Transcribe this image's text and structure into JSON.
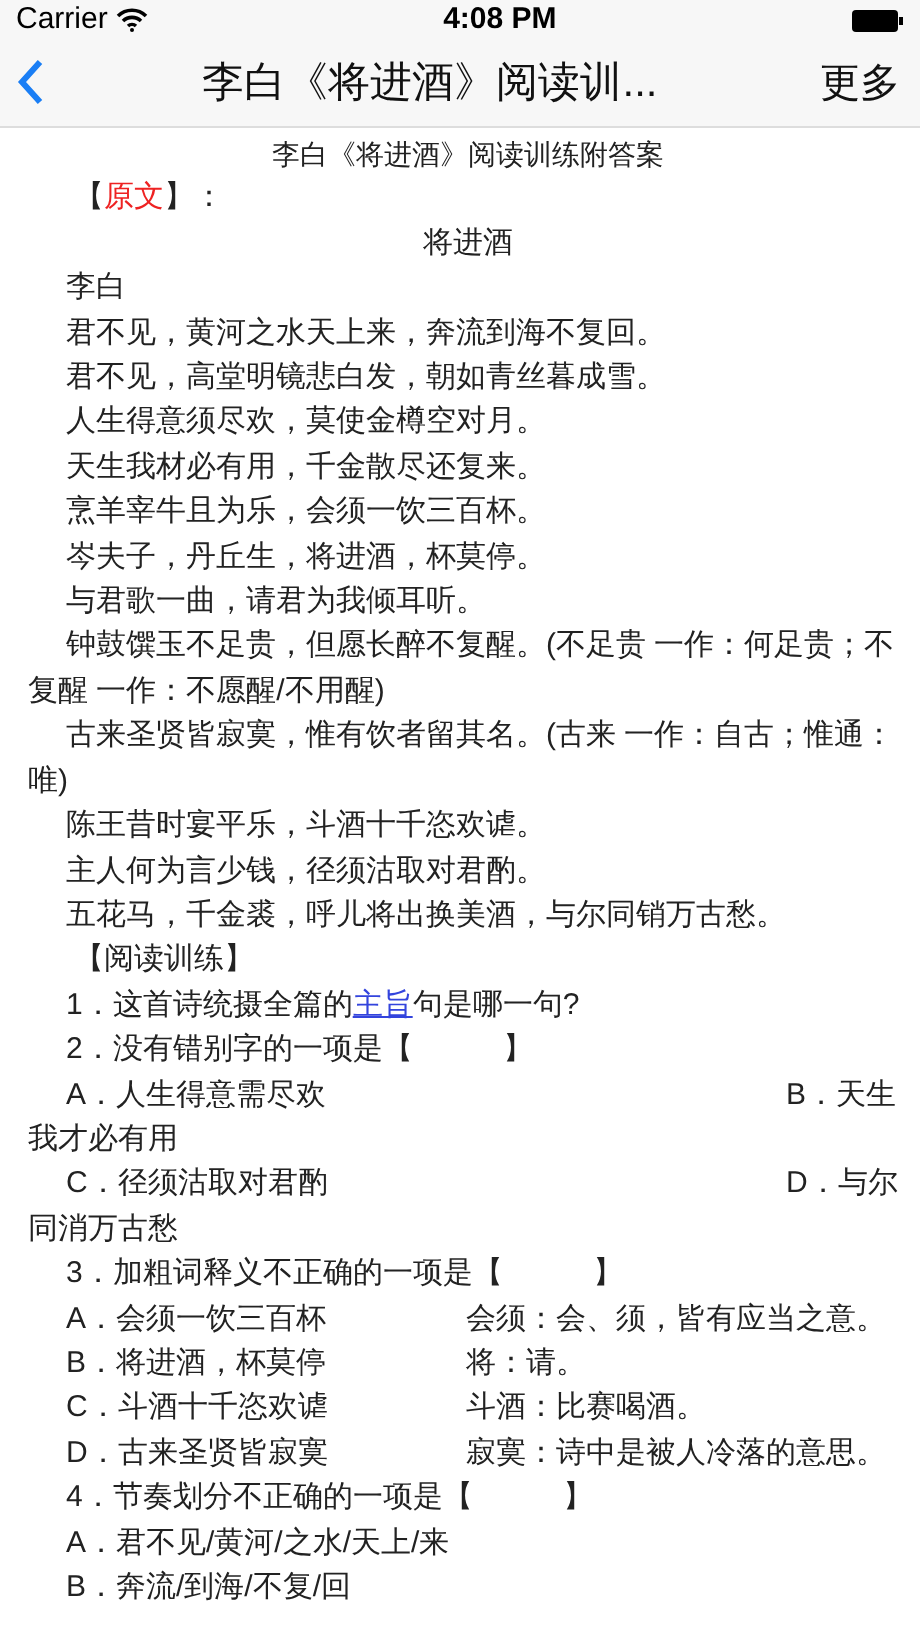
{
  "status_bar": {
    "carrier": "Carrier",
    "time": "4:08 PM"
  },
  "nav": {
    "title": "李白《将进酒》阅读训...",
    "more": "更多"
  },
  "document": [
    {
      "kind": "title",
      "text": "李白《将进酒》阅读训练附答案"
    },
    {
      "kind": "label",
      "open": "【",
      "word": "原文",
      "close": "】：",
      "highlighted": true
    },
    {
      "kind": "center",
      "text": "将进酒"
    },
    {
      "kind": "para",
      "text": "李白"
    },
    {
      "kind": "para",
      "text": "君不见，黄河之水天上来，奔流到海不复回。"
    },
    {
      "kind": "para",
      "text": "君不见，高堂明镜悲白发，朝如青丝暮成雪。"
    },
    {
      "kind": "para",
      "text": "人生得意须尽欢，莫使金樽空对月。"
    },
    {
      "kind": "para",
      "text": "天生我材必有用，千金散尽还复来。"
    },
    {
      "kind": "para",
      "text": "烹羊宰牛且为乐，会须一饮三百杯。"
    },
    {
      "kind": "para",
      "text": "岑夫子，丹丘生，将进酒，杯莫停。"
    },
    {
      "kind": "para",
      "text": "与君歌一曲，请君为我倾耳听。"
    },
    {
      "kind": "para",
      "text": "钟鼓馔玉不足贵，但愿长醉不复醒。(不足贵 一作：何足贵；不复醒 一作：不愿醒/不用醒)"
    },
    {
      "kind": "para",
      "text": "古来圣贤皆寂寞，惟有饮者留其名。(古来 一作：自古；惟通：唯)"
    },
    {
      "kind": "para",
      "text": "陈王昔时宴平乐，斗酒十千恣欢谑。"
    },
    {
      "kind": "para",
      "text": "主人何为言少钱，径须沽取对君酌。"
    },
    {
      "kind": "para",
      "text": "五花马，千金裘，呼儿将出换美酒，与尔同销万古愁。"
    },
    {
      "kind": "label",
      "open": "【",
      "word": "阅读训练",
      "close": "】",
      "highlighted": false
    },
    {
      "kind": "linked",
      "before": "1．这首诗统摄全篇的",
      "link": "主旨",
      "after": "句是哪一句?"
    },
    {
      "kind": "para",
      "text": "2．没有错别字的一项是【　　　】"
    },
    {
      "kind": "pair",
      "left": "A．人生得意需尽欢",
      "right": "B．天生我才必有用"
    },
    {
      "kind": "pair",
      "left": "C．径须沽取对君酌",
      "right": "D．与尔同消万古愁"
    },
    {
      "kind": "para",
      "text": "3．加粗词释义不正确的一项是【　　　】"
    },
    {
      "kind": "gloss",
      "left": "A．会须一饮三百杯",
      "right": "会须：会、须，皆有应当之意。"
    },
    {
      "kind": "gloss",
      "left": "B．将进酒，杯莫停",
      "right": "将：请。"
    },
    {
      "kind": "gloss",
      "left": "C．斗酒十千恣欢谑",
      "right": "斗酒：比赛喝酒。"
    },
    {
      "kind": "gloss",
      "left": "D．古来圣贤皆寂寞",
      "right": "寂寞：诗中是被人冷落的意思。"
    },
    {
      "kind": "para",
      "text": "4．节奏划分不正确的一项是【　　　】"
    },
    {
      "kind": "para",
      "text": "A．君不见/黄河/之水/天上/来"
    },
    {
      "kind": "para",
      "text": "B．奔流/到海/不复/回"
    }
  ]
}
